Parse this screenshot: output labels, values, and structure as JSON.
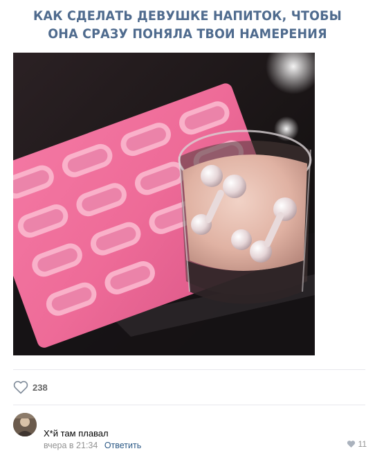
{
  "post": {
    "caption_lines": [
      "КАК СДЕЛАТЬ ДЕВУШКЕ НАПИТОК, ЧТОБЫ",
      "ОНА СРАЗУ ПОНЯЛА ТВОИ НАМЕРЕНИЯ"
    ],
    "likes_count": "238",
    "icons": {
      "like": "heart-outline-icon"
    },
    "colors": {
      "caption": "#4f6b8e",
      "likes_text": "#656565",
      "divider": "#e7e8ec"
    }
  },
  "comment": {
    "text": "Х*й там плавал",
    "time": "вчера в 21:34",
    "reply_label": "Ответить",
    "likes_count": "11",
    "colors": {
      "link": "#2a5885",
      "meta": "#939393"
    }
  }
}
